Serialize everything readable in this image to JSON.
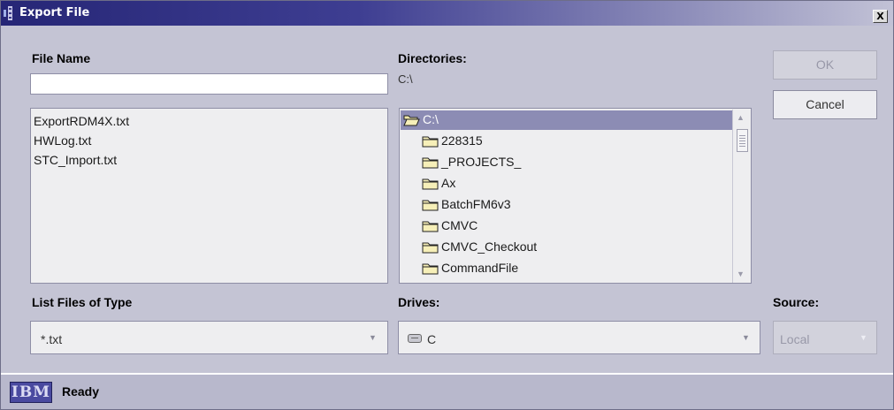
{
  "window": {
    "title": "Export File",
    "close_label": "X"
  },
  "file_name": {
    "label": "File Name",
    "value": "",
    "files": [
      "ExportRDM4X.txt",
      "HWLog.txt",
      "STC_Import.txt"
    ]
  },
  "directories": {
    "label": "Directories:",
    "current_path": "C:\\",
    "items": [
      "C:\\",
      "228315",
      "_PROJECTS_",
      "Ax",
      "BatchFM6v3",
      "CMVC",
      "CMVC_Checkout",
      "CommandFile"
    ],
    "selected_index": 0
  },
  "buttons": {
    "ok": "OK",
    "cancel": "Cancel"
  },
  "file_type": {
    "label": "List Files of Type",
    "selected": "*.txt"
  },
  "drives": {
    "label": "Drives:",
    "selected": "C"
  },
  "source": {
    "label": "Source:",
    "selected": "Local"
  },
  "status": {
    "logo": "IBM",
    "text": "Ready"
  },
  "colors": {
    "titlebar_start": "#262676",
    "selection": "#8c8cb4",
    "dialog_bg": "#c4c4d4"
  }
}
